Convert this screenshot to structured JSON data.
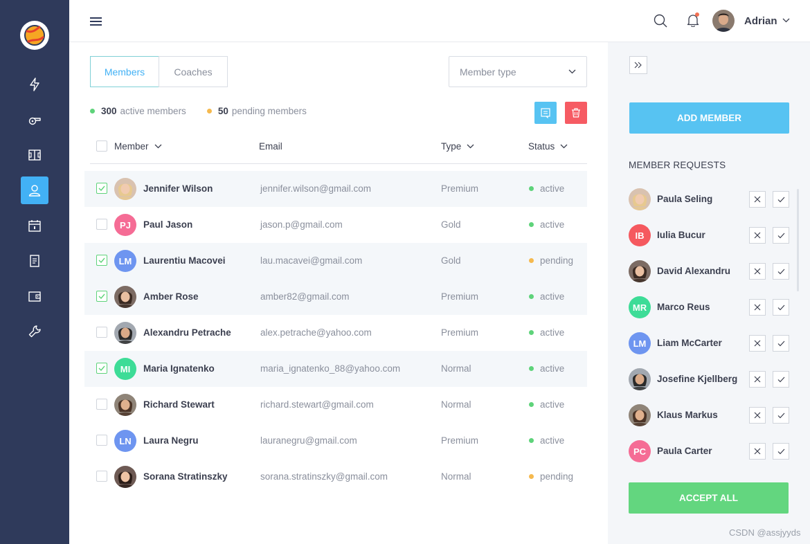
{
  "header": {
    "user_name": "Adrian"
  },
  "sidebar": {
    "items": [
      {
        "icon": "bolt-icon"
      },
      {
        "icon": "whistle-icon"
      },
      {
        "icon": "field-icon"
      },
      {
        "icon": "user-icon",
        "active": true
      },
      {
        "icon": "calendar-icon"
      },
      {
        "icon": "document-icon"
      },
      {
        "icon": "wallet-icon"
      },
      {
        "icon": "wrench-icon"
      }
    ]
  },
  "main": {
    "tabs": [
      {
        "label": "Members",
        "active": true
      },
      {
        "label": "Coaches",
        "active": false
      }
    ],
    "member_type_placeholder": "Member type",
    "stats": {
      "active_count": "300",
      "active_label": "active members",
      "pending_count": "50",
      "pending_label": "pending members"
    },
    "columns": {
      "member": "Member",
      "email": "Email",
      "type": "Type",
      "status": "Status"
    },
    "rows": [
      {
        "name": "Jennifer Wilson",
        "email": "jennifer.wilson@gmail.com",
        "type": "Premium",
        "status": "active",
        "checked": true,
        "highlight": true,
        "initials": "",
        "photo": true
      },
      {
        "name": "Paul Jason",
        "email": "jason.p@gmail.com",
        "type": "Gold",
        "status": "active",
        "checked": false,
        "highlight": false,
        "initials": "PJ",
        "color": "#f56c95"
      },
      {
        "name": "Laurentiu Macovei",
        "email": "lau.macavei@gmail.com",
        "type": "Gold",
        "status": "pending",
        "checked": true,
        "highlight": true,
        "initials": "LM",
        "color": "#6e95f0"
      },
      {
        "name": "Amber Rose",
        "email": "amber82@gmail.com",
        "type": "Premium",
        "status": "active",
        "checked": true,
        "highlight": true,
        "initials": "",
        "photo": true
      },
      {
        "name": "Alexandru Petrache",
        "email": "alex.petrache@yahoo.com",
        "type": "Premium",
        "status": "active",
        "checked": false,
        "highlight": false,
        "initials": "",
        "photo": true
      },
      {
        "name": "Maria Ignatenko",
        "email": "maria_ignatenko_88@yahoo.com",
        "type": "Normal",
        "status": "active",
        "checked": true,
        "highlight": true,
        "initials": "MI",
        "color": "#3ddc97"
      },
      {
        "name": "Richard Stewart",
        "email": "richard.stewart@gmail.com",
        "type": "Normal",
        "status": "active",
        "checked": false,
        "highlight": false,
        "initials": "",
        "photo": true
      },
      {
        "name": "Laura Negru",
        "email": "lauranegru@gmail.com",
        "type": "Premium",
        "status": "active",
        "checked": false,
        "highlight": false,
        "initials": "LN",
        "color": "#6e95f0"
      },
      {
        "name": "Sorana Stratinszky",
        "email": "sorana.stratinszky@gmail.com",
        "type": "Normal",
        "status": "pending",
        "checked": false,
        "highlight": false,
        "initials": "",
        "photo": true
      }
    ]
  },
  "panel": {
    "add_member_label": "ADD MEMBER",
    "requests_title": "MEMBER REQUESTS",
    "requests": [
      {
        "name": "Paula Seling",
        "initials": "",
        "photo": true
      },
      {
        "name": "Iulia Bucur",
        "initials": "IB",
        "color": "#f5595f"
      },
      {
        "name": "David Alexandru",
        "initials": "",
        "photo": true
      },
      {
        "name": "Marco Reus",
        "initials": "MR",
        "color": "#3ddc97"
      },
      {
        "name": "Liam McCarter",
        "initials": "LM",
        "color": "#6e95f0"
      },
      {
        "name": "Josefine Kjellberg",
        "initials": "",
        "photo": true
      },
      {
        "name": "Klaus Markus",
        "initials": "",
        "photo": true
      },
      {
        "name": "Paula Carter",
        "initials": "PC",
        "color": "#f56c95"
      }
    ],
    "accept_all_label": "ACCEPT ALL"
  },
  "colors": {
    "active": "#5ed37a",
    "pending": "#f5b94e"
  },
  "watermark": "CSDN @assjyyds"
}
